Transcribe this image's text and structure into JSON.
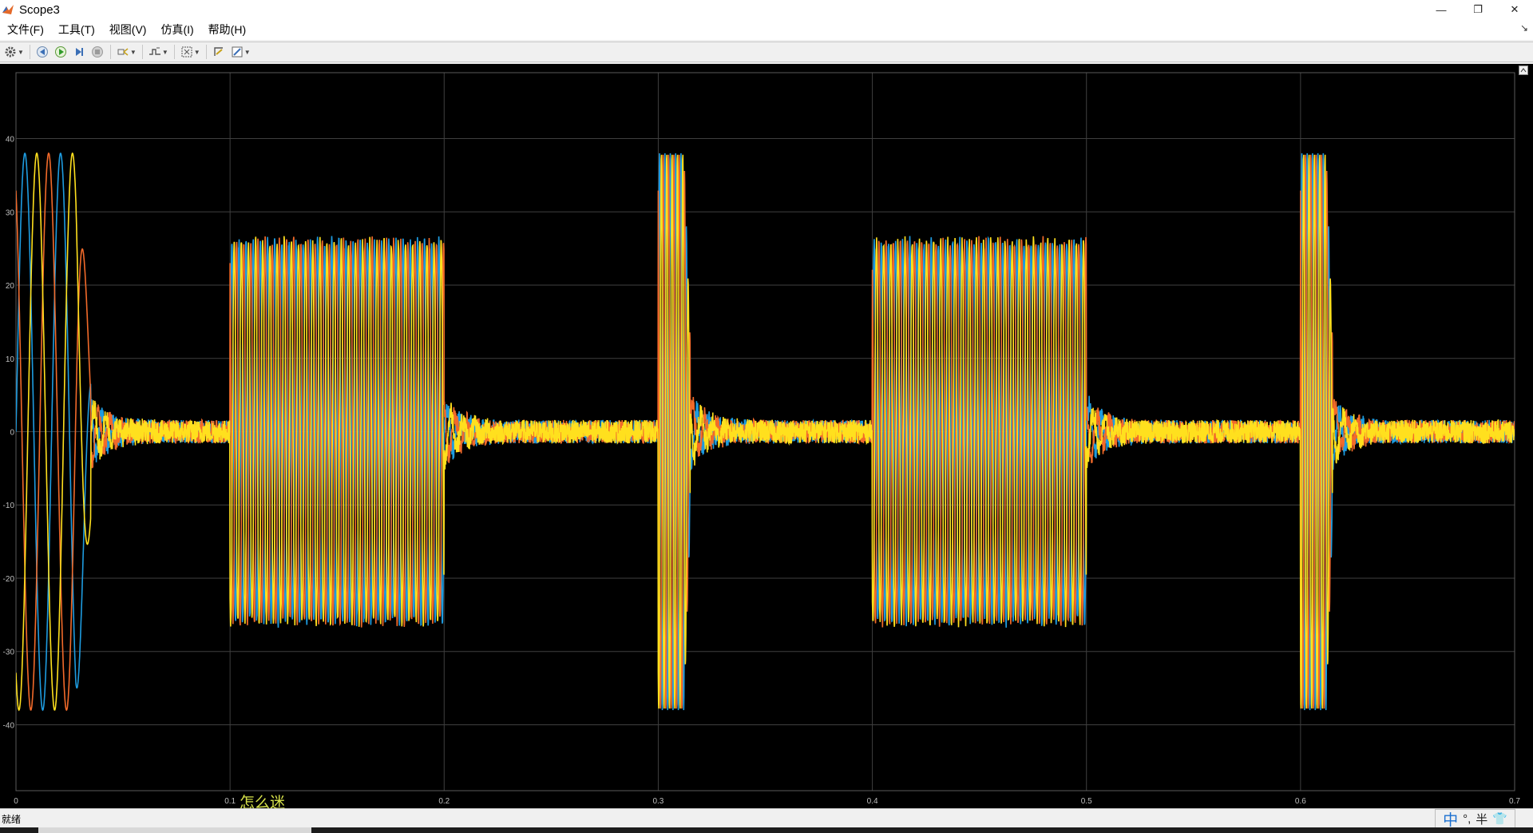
{
  "window": {
    "title": "Scope3",
    "controls": {
      "minimize": "—",
      "restore": "❐",
      "close": "✕"
    }
  },
  "menu": {
    "items": [
      "文件(F)",
      "工具(T)",
      "视图(V)",
      "仿真(I)",
      "帮助(H)"
    ],
    "extra": "↘"
  },
  "toolbar": {
    "buttons": [
      {
        "name": "configuration-icon",
        "glyph": "⚙",
        "dropdown": true
      },
      {
        "name": "step-back-icon",
        "glyph": "◀",
        "dropdown": false
      },
      {
        "name": "run-icon",
        "glyph": "▶",
        "dropdown": false
      },
      {
        "name": "step-forward-icon",
        "glyph": "▶|",
        "dropdown": false
      },
      {
        "name": "stop-icon",
        "glyph": "■",
        "dropdown": false
      },
      {
        "name": "highlight-block-icon",
        "glyph": "⛭",
        "dropdown": true
      },
      {
        "name": "trigger-icon",
        "glyph": "⤢",
        "dropdown": true
      },
      {
        "name": "zoom-icon",
        "glyph": "⛶",
        "dropdown": true
      },
      {
        "name": "scale-axes-icon",
        "glyph": "⇱",
        "dropdown": false
      },
      {
        "name": "style-icon",
        "glyph": "✎",
        "dropdown": true
      }
    ]
  },
  "status": {
    "text": "就绪"
  },
  "ime": {
    "lang": "中",
    "punct": "°,",
    "width": "半",
    "skin": "👕"
  },
  "overlay_text": "怎么迷",
  "colors": {
    "plot_bg": "#000000",
    "grid": "#3f3f3f",
    "axis_text": "#bfbfbf",
    "series_blue": "#1e9ce0",
    "series_orange": "#f26a2a",
    "series_yellow": "#ffe01e"
  },
  "chart_data": {
    "type": "line",
    "title": "",
    "xlabel": "",
    "ylabel": "",
    "xlim": [
      0,
      0.7
    ],
    "ylim": [
      -49,
      49
    ],
    "xticks": [
      0,
      0.1,
      0.2,
      0.3,
      0.4,
      0.5,
      0.6,
      0.7
    ],
    "xtick_labels": [
      "0",
      "0.1",
      "0.2",
      "0.3",
      "0.4",
      "0.5",
      "0.6",
      "0.7"
    ],
    "yticks": [
      -40,
      -30,
      -20,
      -10,
      0,
      10,
      20,
      30,
      40
    ],
    "ytick_labels": [
      "-40",
      "-30",
      "-20",
      "-10",
      "0",
      "10",
      "20",
      "30",
      "40"
    ],
    "grid": true,
    "description_segments": [
      {
        "t0": 0.0,
        "t1": 0.035,
        "amplitude": 38,
        "frequency_hz": 60,
        "kind": "transient"
      },
      {
        "t0": 0.035,
        "t1": 0.1,
        "amplitude": 1,
        "kind": "noise"
      },
      {
        "t0": 0.1,
        "t1": 0.2,
        "amplitude": 26,
        "frequency_hz": 300,
        "kind": "oscillation"
      },
      {
        "t0": 0.2,
        "t1": 0.3,
        "amplitude": 1,
        "kind": "noise"
      },
      {
        "t0": 0.3,
        "t1": 0.315,
        "amplitude": 38,
        "frequency_hz": 400,
        "kind": "transient"
      },
      {
        "t0": 0.315,
        "t1": 0.4,
        "amplitude": 1,
        "kind": "noise"
      },
      {
        "t0": 0.4,
        "t1": 0.5,
        "amplitude": 26,
        "frequency_hz": 300,
        "kind": "oscillation"
      },
      {
        "t0": 0.5,
        "t1": 0.6,
        "amplitude": 1,
        "kind": "noise"
      },
      {
        "t0": 0.6,
        "t1": 0.615,
        "amplitude": 38,
        "frequency_hz": 400,
        "kind": "transient"
      },
      {
        "t0": 0.615,
        "t1": 0.7,
        "amplitude": 1,
        "kind": "noise"
      }
    ],
    "series": [
      {
        "color": "#1e9ce0",
        "phase_deg": 0
      },
      {
        "color": "#f26a2a",
        "phase_deg": 120
      },
      {
        "color": "#ffe01e",
        "phase_deg": 240
      }
    ]
  }
}
